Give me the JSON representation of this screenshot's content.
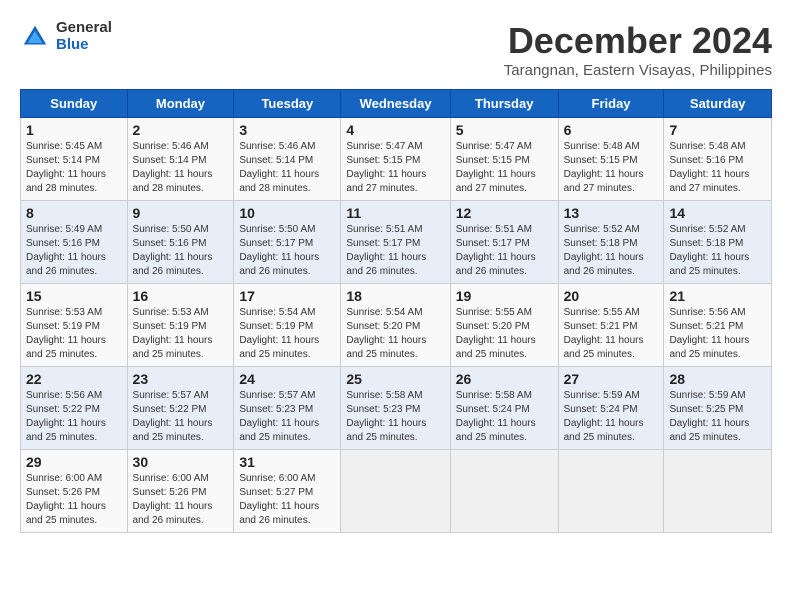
{
  "header": {
    "logo_general": "General",
    "logo_blue": "Blue",
    "title": "December 2024",
    "subtitle": "Tarangnan, Eastern Visayas, Philippines"
  },
  "calendar": {
    "days_of_week": [
      "Sunday",
      "Monday",
      "Tuesday",
      "Wednesday",
      "Thursday",
      "Friday",
      "Saturday"
    ],
    "weeks": [
      [
        {
          "day": "",
          "empty": true
        },
        {
          "day": "",
          "empty": true
        },
        {
          "day": "",
          "empty": true
        },
        {
          "day": "",
          "empty": true
        },
        {
          "day": "",
          "empty": true
        },
        {
          "day": "",
          "empty": true
        },
        {
          "day": "",
          "empty": true
        }
      ],
      [
        {
          "day": "1",
          "sunrise": "Sunrise: 5:45 AM",
          "sunset": "Sunset: 5:14 PM",
          "daylight": "Daylight: 11 hours and 28 minutes."
        },
        {
          "day": "2",
          "sunrise": "Sunrise: 5:46 AM",
          "sunset": "Sunset: 5:14 PM",
          "daylight": "Daylight: 11 hours and 28 minutes."
        },
        {
          "day": "3",
          "sunrise": "Sunrise: 5:46 AM",
          "sunset": "Sunset: 5:14 PM",
          "daylight": "Daylight: 11 hours and 28 minutes."
        },
        {
          "day": "4",
          "sunrise": "Sunrise: 5:47 AM",
          "sunset": "Sunset: 5:15 PM",
          "daylight": "Daylight: 11 hours and 27 minutes."
        },
        {
          "day": "5",
          "sunrise": "Sunrise: 5:47 AM",
          "sunset": "Sunset: 5:15 PM",
          "daylight": "Daylight: 11 hours and 27 minutes."
        },
        {
          "day": "6",
          "sunrise": "Sunrise: 5:48 AM",
          "sunset": "Sunset: 5:15 PM",
          "daylight": "Daylight: 11 hours and 27 minutes."
        },
        {
          "day": "7",
          "sunrise": "Sunrise: 5:48 AM",
          "sunset": "Sunset: 5:16 PM",
          "daylight": "Daylight: 11 hours and 27 minutes."
        }
      ],
      [
        {
          "day": "8",
          "sunrise": "Sunrise: 5:49 AM",
          "sunset": "Sunset: 5:16 PM",
          "daylight": "Daylight: 11 hours and 26 minutes."
        },
        {
          "day": "9",
          "sunrise": "Sunrise: 5:50 AM",
          "sunset": "Sunset: 5:16 PM",
          "daylight": "Daylight: 11 hours and 26 minutes."
        },
        {
          "day": "10",
          "sunrise": "Sunrise: 5:50 AM",
          "sunset": "Sunset: 5:17 PM",
          "daylight": "Daylight: 11 hours and 26 minutes."
        },
        {
          "day": "11",
          "sunrise": "Sunrise: 5:51 AM",
          "sunset": "Sunset: 5:17 PM",
          "daylight": "Daylight: 11 hours and 26 minutes."
        },
        {
          "day": "12",
          "sunrise": "Sunrise: 5:51 AM",
          "sunset": "Sunset: 5:17 PM",
          "daylight": "Daylight: 11 hours and 26 minutes."
        },
        {
          "day": "13",
          "sunrise": "Sunrise: 5:52 AM",
          "sunset": "Sunset: 5:18 PM",
          "daylight": "Daylight: 11 hours and 26 minutes."
        },
        {
          "day": "14",
          "sunrise": "Sunrise: 5:52 AM",
          "sunset": "Sunset: 5:18 PM",
          "daylight": "Daylight: 11 hours and 25 minutes."
        }
      ],
      [
        {
          "day": "15",
          "sunrise": "Sunrise: 5:53 AM",
          "sunset": "Sunset: 5:19 PM",
          "daylight": "Daylight: 11 hours and 25 minutes."
        },
        {
          "day": "16",
          "sunrise": "Sunrise: 5:53 AM",
          "sunset": "Sunset: 5:19 PM",
          "daylight": "Daylight: 11 hours and 25 minutes."
        },
        {
          "day": "17",
          "sunrise": "Sunrise: 5:54 AM",
          "sunset": "Sunset: 5:19 PM",
          "daylight": "Daylight: 11 hours and 25 minutes."
        },
        {
          "day": "18",
          "sunrise": "Sunrise: 5:54 AM",
          "sunset": "Sunset: 5:20 PM",
          "daylight": "Daylight: 11 hours and 25 minutes."
        },
        {
          "day": "19",
          "sunrise": "Sunrise: 5:55 AM",
          "sunset": "Sunset: 5:20 PM",
          "daylight": "Daylight: 11 hours and 25 minutes."
        },
        {
          "day": "20",
          "sunrise": "Sunrise: 5:55 AM",
          "sunset": "Sunset: 5:21 PM",
          "daylight": "Daylight: 11 hours and 25 minutes."
        },
        {
          "day": "21",
          "sunrise": "Sunrise: 5:56 AM",
          "sunset": "Sunset: 5:21 PM",
          "daylight": "Daylight: 11 hours and 25 minutes."
        }
      ],
      [
        {
          "day": "22",
          "sunrise": "Sunrise: 5:56 AM",
          "sunset": "Sunset: 5:22 PM",
          "daylight": "Daylight: 11 hours and 25 minutes."
        },
        {
          "day": "23",
          "sunrise": "Sunrise: 5:57 AM",
          "sunset": "Sunset: 5:22 PM",
          "daylight": "Daylight: 11 hours and 25 minutes."
        },
        {
          "day": "24",
          "sunrise": "Sunrise: 5:57 AM",
          "sunset": "Sunset: 5:23 PM",
          "daylight": "Daylight: 11 hours and 25 minutes."
        },
        {
          "day": "25",
          "sunrise": "Sunrise: 5:58 AM",
          "sunset": "Sunset: 5:23 PM",
          "daylight": "Daylight: 11 hours and 25 minutes."
        },
        {
          "day": "26",
          "sunrise": "Sunrise: 5:58 AM",
          "sunset": "Sunset: 5:24 PM",
          "daylight": "Daylight: 11 hours and 25 minutes."
        },
        {
          "day": "27",
          "sunrise": "Sunrise: 5:59 AM",
          "sunset": "Sunset: 5:24 PM",
          "daylight": "Daylight: 11 hours and 25 minutes."
        },
        {
          "day": "28",
          "sunrise": "Sunrise: 5:59 AM",
          "sunset": "Sunset: 5:25 PM",
          "daylight": "Daylight: 11 hours and 25 minutes."
        }
      ],
      [
        {
          "day": "29",
          "sunrise": "Sunrise: 6:00 AM",
          "sunset": "Sunset: 5:26 PM",
          "daylight": "Daylight: 11 hours and 25 minutes."
        },
        {
          "day": "30",
          "sunrise": "Sunrise: 6:00 AM",
          "sunset": "Sunset: 5:26 PM",
          "daylight": "Daylight: 11 hours and 26 minutes."
        },
        {
          "day": "31",
          "sunrise": "Sunrise: 6:00 AM",
          "sunset": "Sunset: 5:27 PM",
          "daylight": "Daylight: 11 hours and 26 minutes."
        },
        {
          "day": "",
          "empty": true
        },
        {
          "day": "",
          "empty": true
        },
        {
          "day": "",
          "empty": true
        },
        {
          "day": "",
          "empty": true
        }
      ]
    ]
  }
}
